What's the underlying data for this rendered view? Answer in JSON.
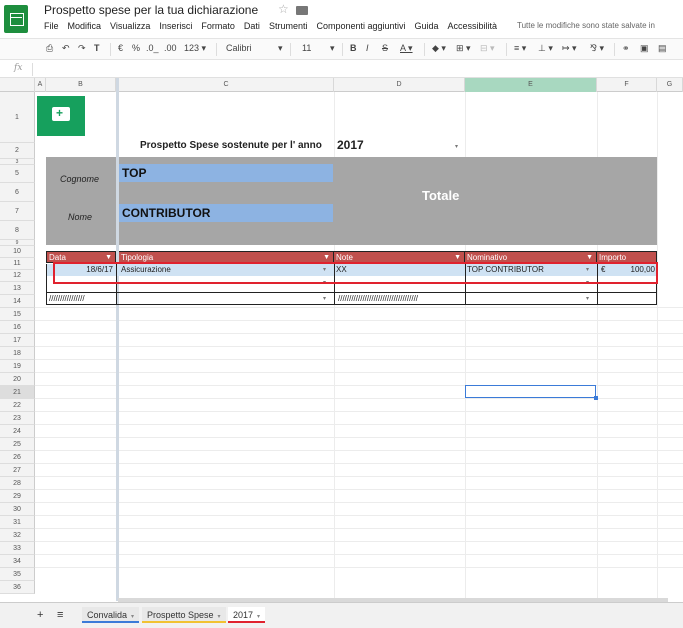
{
  "app": {
    "doc_title": "Prospetto spese per la tua dichiarazione",
    "menu": [
      "File",
      "Modifica",
      "Visualizza",
      "Inserisci",
      "Formato",
      "Dati",
      "Strumenti",
      "Componenti aggiuntivi",
      "Guida",
      "Accessibilità"
    ],
    "save_status": "Tutte le modifiche sono state salvate in"
  },
  "toolbar": {
    "currency": "€",
    "percent": "%",
    "decimals_less": ".0_",
    "decimals_more": ".00",
    "more_formats": "123",
    "font": "Calibri",
    "font_size": "11",
    "bold": "B",
    "italic": "I",
    "strike": "S",
    "text_color": "A"
  },
  "formula_bar": {
    "fx": "fx",
    "value": ""
  },
  "columns": [
    "A",
    "B",
    "C",
    "D",
    "E",
    "F",
    "G"
  ],
  "rows": [
    "1",
    "2",
    "3",
    "5",
    "6",
    "7",
    "8",
    "9",
    "10",
    "11",
    "12",
    "13",
    "14",
    "15",
    "16",
    "17",
    "18",
    "19",
    "20",
    "21",
    "22",
    "23",
    "24",
    "25",
    "26",
    "27",
    "28",
    "29",
    "30",
    "31",
    "32",
    "33",
    "34",
    "35",
    "36"
  ],
  "sheet": {
    "heading_label": "Prospetto Spese sostenute per l' anno",
    "year": "2017",
    "cognome_label": "Cognome",
    "cognome_value": "TOP",
    "nome_label": "Nome",
    "nome_value": "CONTRIBUTOR",
    "totale_label": "Totale",
    "table_headers": [
      "Data",
      "Tipologia",
      "Note",
      "Nominativo",
      "Importo"
    ],
    "row_11": {
      "data": "18/6/17",
      "tipologia": "Assicurazione",
      "note": "XX",
      "nominativo": "TOP CONTRIBUTOR",
      "currency": "€",
      "importo": "100,00"
    },
    "row_13": {
      "data": "////////////////",
      "note": "////////////////////////////////////"
    }
  },
  "tabs": [
    {
      "label": "Convalida",
      "color": "#3b7bd8"
    },
    {
      "label": "Prospetto Spese",
      "color": "#f1c232"
    },
    {
      "label": "2017",
      "color": "#e0222e"
    }
  ],
  "colors": {
    "header_red": "#c0504d",
    "input_blue": "#8db3e2",
    "panel_grey": "#a6a6a6",
    "highlight_red": "#e0222e",
    "logo_green": "#16a05d"
  }
}
